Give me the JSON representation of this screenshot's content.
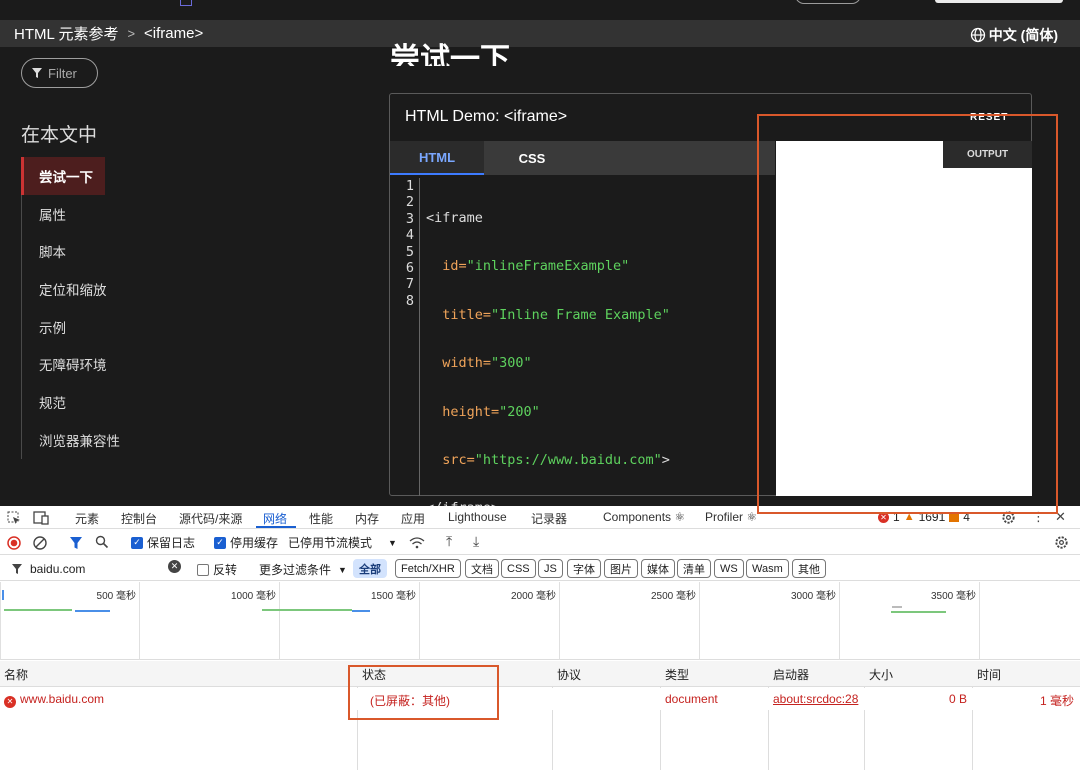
{
  "mdn": {
    "breadcrumb": {
      "parent": "HTML 元素参考",
      "separator": ">",
      "current": "<iframe>"
    },
    "language_label": "中文 (简体)",
    "filter_placeholder": "Filter",
    "page_heading": "尝试一下",
    "toc": {
      "title": "在本文中",
      "items": [
        "尝试一下",
        "属性",
        "脚本",
        "定位和缩放",
        "示例",
        "无障碍环境",
        "规范",
        "浏览器兼容性"
      ]
    },
    "demo": {
      "title": "HTML Demo: <iframe>",
      "reset_label": "RESET",
      "tabs": [
        "HTML",
        "CSS"
      ],
      "output_label": "OUTPUT",
      "line_numbers": [
        "1",
        "2",
        "3",
        "4",
        "5",
        "6",
        "7",
        "8"
      ],
      "code": {
        "l1": "<iframe",
        "l2_attr": "id=",
        "l2_val": "\"inlineFrameExample\"",
        "l3_attr": "title=",
        "l3_val": "\"Inline Frame Example\"",
        "l4_attr": "width=",
        "l4_val": "\"300\"",
        "l5_attr": "height=",
        "l5_val": "\"200\"",
        "l6_attr": "src=",
        "l6_val": "\"https://www.baidu.com\"",
        "l6_end": ">",
        "l7": "</iframe>"
      }
    }
  },
  "devtools": {
    "tabs": [
      "元素",
      "控制台",
      "源代码/来源",
      "网络",
      "性能",
      "内存",
      "应用",
      "Lighthouse",
      "记录器",
      "Components ⚛",
      "Profiler ⚛"
    ],
    "active_tab": "网络",
    "issues": {
      "errors": "1",
      "warnings": "1691",
      "info": "4"
    },
    "toolbar": {
      "preserve_log": "保留日志",
      "disable_cache": "停用缓存",
      "throttling": "已停用节流模式"
    },
    "filter": {
      "value": "baidu.com",
      "invert_label": "反转",
      "more_filters": "更多过滤条件",
      "types": [
        "全部",
        "Fetch/XHR",
        "文档",
        "CSS",
        "JS",
        "字体",
        "图片",
        "媒体",
        "清单",
        "WS",
        "Wasm",
        "其他"
      ]
    },
    "overview_ticks": [
      "500 毫秒",
      "1000 毫秒",
      "1500 毫秒",
      "2000 毫秒",
      "2500 毫秒",
      "3000 毫秒",
      "3500 毫秒"
    ],
    "columns": [
      "名称",
      "状态",
      "协议",
      "类型",
      "启动器",
      "大小",
      "时间"
    ],
    "rows": [
      {
        "name": "www.baidu.com",
        "status": "(已屏蔽：其他)",
        "protocol": "",
        "type": "document",
        "initiator": "about:srcdoc:28",
        "size": "0 B",
        "time": "1 毫秒"
      }
    ],
    "colors": {
      "accent": "#1a5fd1",
      "error": "#c5221f",
      "highlight": "#d9582b"
    }
  }
}
